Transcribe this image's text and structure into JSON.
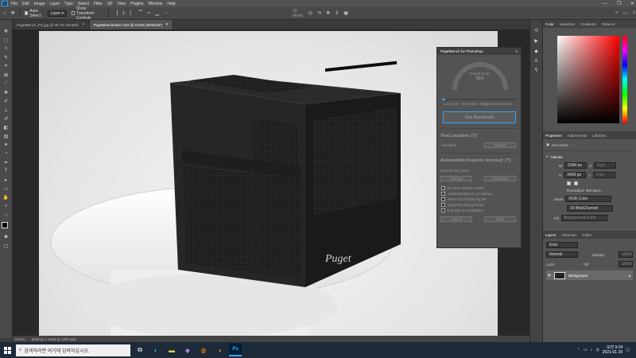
{
  "menu": [
    "File",
    "Edit",
    "Image",
    "Layer",
    "Type",
    "Select",
    "Filter",
    "3D",
    "View",
    "Plugins",
    "Window",
    "Help"
  ],
  "options_bar": {
    "auto_select_label": "Auto-Select:",
    "layer_select": "Layer",
    "show_transform_label": "Show Transform Controls",
    "mode_3d_label": "3D Mode:"
  },
  "tabs": [
    {
      "label": "PugetBench_PS.jpg @ 66.7% (RGB/8)"
    },
    {
      "label": "PugetBenchmark.CR2 @ 8.53% (RGB/16*)"
    }
  ],
  "status": {
    "zoom": "8.53%",
    "size": "5184 px x 3456 px (300 ppi)"
  },
  "plugin": {
    "title": "PugetBench for Photoshop",
    "overall_score_label": "Overall Score",
    "overall_score_value": "N/A",
    "progress_text": "Loop: 1/5 - Test: 6/16 - Magic Wand Select",
    "run_button": "Run Benchmark",
    "test_location_title": "Test Location: [?]",
    "test_location_value": "~/Desktop",
    "change_label": "Change",
    "automation_title": "Automation (requires license): [?]",
    "license_key": "License Key (N/A)",
    "purchase_label": "Purchase",
    "options": [
      "Do NOT upload results",
      "Automatically run on startup",
      "Write CSV/JSON log file",
      "Suppress dialog boxes",
      "Exit app on completion"
    ],
    "cancel_label": "Cancel",
    "save_label": "Save"
  },
  "color_panel": {
    "tabs": [
      "Color",
      "Swatches",
      "Gradients",
      "Patterns"
    ]
  },
  "properties": {
    "tabs": [
      "Properties",
      "Adjustments",
      "Libraries"
    ],
    "document_label": "Document",
    "canvas_label": "Canvas",
    "w_label": "W",
    "w_value": "5184 px",
    "h_label": "H",
    "h_value": "3456 px",
    "x_label": "X",
    "x_value": "0 px",
    "y_label": "Y",
    "y_value": "0 px",
    "resolution": "Resolution: 300 pixel...",
    "mode_label": "Mode",
    "mode_value": "RGB Color",
    "bits_value": "16 Bits/Channel",
    "fill_label": "Fill",
    "fill_value": "Background Color"
  },
  "layers": {
    "tabs": [
      "Layers",
      "Channels",
      "Paths"
    ],
    "kind_label": "Kind",
    "blend_mode": "Normal",
    "opacity_label": "Opacity:",
    "opacity_value": "100%",
    "lock_label": "Lock:",
    "fill_label": "Fill:",
    "fill_value": "100%",
    "layer_name": "Background"
  },
  "taskbar": {
    "search_placeholder": "검색하려면 여기에 입력하십시오.",
    "time": "오전 9:24",
    "date": "2021-01-20",
    "lang": "가"
  },
  "colors": {
    "accent": "#31a8ff",
    "taskbar": "#1c2a3a",
    "panel": "#535353"
  }
}
